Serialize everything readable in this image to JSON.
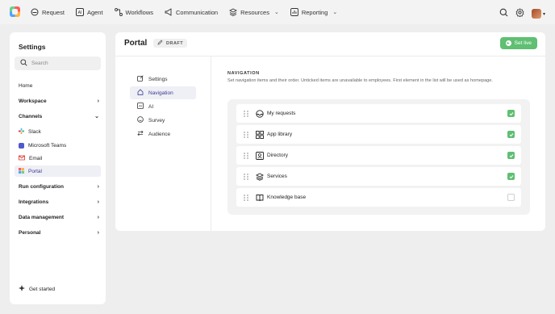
{
  "topnav": {
    "items": [
      {
        "label": "Request",
        "icon": "request-icon",
        "chevron": false
      },
      {
        "label": "Agent",
        "icon": "ai-agent-icon",
        "chevron": false
      },
      {
        "label": "Workflows",
        "icon": "workflow-icon",
        "chevron": false
      },
      {
        "label": "Communication",
        "icon": "megaphone-icon",
        "chevron": false
      },
      {
        "label": "Resources",
        "icon": "layers-icon",
        "chevron": true
      },
      {
        "label": "Reporting",
        "icon": "chart-icon",
        "chevron": true
      }
    ]
  },
  "sidebar": {
    "title": "Settings",
    "search_placeholder": "Search",
    "home": "Home",
    "workspace": "Workspace",
    "channels": "Channels",
    "channel_items": [
      {
        "label": "Slack",
        "color": "#e01e5a"
      },
      {
        "label": "Microsoft Teams",
        "color": "#5059c9"
      },
      {
        "label": "Email",
        "color": "#d93025"
      },
      {
        "label": "Portal",
        "color": "#ff7a45"
      }
    ],
    "run_configuration": "Run configuration",
    "integrations": "Integrations",
    "data_management": "Data management",
    "personal": "Personal",
    "get_started": "Get started"
  },
  "main": {
    "title": "Portal",
    "badge": "DRAFT",
    "go_live": "Set live",
    "subnav": [
      {
        "label": "Settings",
        "icon": "edit-icon"
      },
      {
        "label": "Navigation",
        "icon": "home-icon"
      },
      {
        "label": "AI",
        "icon": "ai-icon"
      },
      {
        "label": "Survey",
        "icon": "smiley-icon"
      },
      {
        "label": "Audience",
        "icon": "arrows-icon"
      }
    ],
    "section_title": "NAVIGATION",
    "section_desc": "Set navigation items and their order. Unticked items are unavailable to employees. First element in the list will be used as homepage.",
    "nav_items": [
      {
        "label": "My requests",
        "icon": "inbox-icon",
        "checked": true
      },
      {
        "label": "App library",
        "icon": "grid-icon",
        "checked": true
      },
      {
        "label": "Directory",
        "icon": "contact-icon",
        "checked": true
      },
      {
        "label": "Services",
        "icon": "stack-icon",
        "checked": true
      },
      {
        "label": "Knowledge base",
        "icon": "book-icon",
        "checked": false
      }
    ]
  },
  "colors": {
    "accent": "#5fbf72",
    "active_bg": "#efeff6",
    "active_text": "#3b3b8f"
  }
}
